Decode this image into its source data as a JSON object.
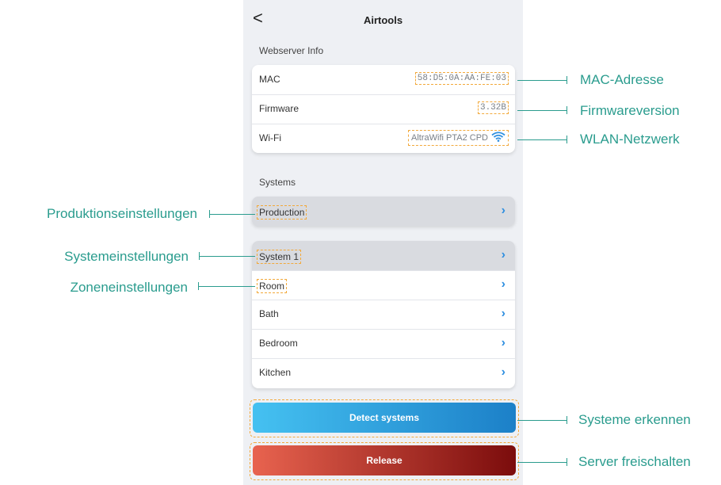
{
  "header": {
    "back_label": "<",
    "title": "Airtools"
  },
  "webserver": {
    "section_title": "Webserver Info",
    "rows": [
      {
        "label": "MAC",
        "value": "58:D5:0A:AA:FE:03"
      },
      {
        "label": "Firmware",
        "value": "3.32B"
      },
      {
        "label": "Wi-Fi",
        "value": "AltraWifi PTA2 CPD",
        "icon": "wifi-icon"
      }
    ]
  },
  "systems": {
    "section_title": "Systems",
    "production": "Production",
    "system": "System 1",
    "zones": [
      "Room",
      "Bath",
      "Bedroom",
      "Kitchen"
    ],
    "chevron": "›"
  },
  "buttons": {
    "detect": "Detect systems",
    "release": "Release"
  },
  "annotations": {
    "mac": "MAC-Adresse",
    "firmware": "Firmwareversion",
    "wlan": "WLAN-Netzwerk",
    "production": "Produktionseinstellungen",
    "system": "Systemeinstellungen",
    "zone": "Zoneneinstellungen",
    "detect": "Systeme erkennen",
    "release": "Server freischalten"
  },
  "colors": {
    "annotation": "#2a9c8e",
    "highlight": "#f2a93b",
    "chevron": "#2f8fe0"
  }
}
